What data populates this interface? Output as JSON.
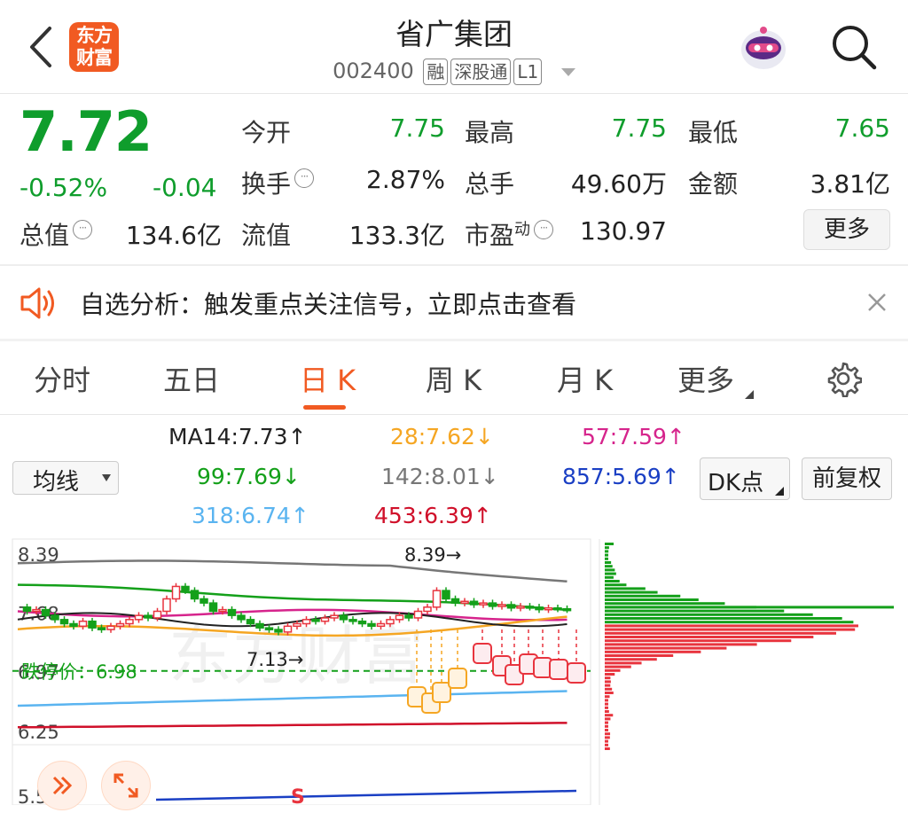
{
  "header": {
    "app_logo_text": [
      "东方",
      "财富"
    ],
    "title": "省广集团",
    "code": "002400",
    "tags": [
      "融",
      "深股通",
      "L1"
    ]
  },
  "quote": {
    "price": "7.72",
    "change_pct": "-0.52%",
    "change": "-0.04",
    "fields": [
      {
        "label": "今开",
        "value": "7.75",
        "color": "green"
      },
      {
        "label": "最高",
        "value": "7.75",
        "color": "green"
      },
      {
        "label": "最低",
        "value": "7.65",
        "color": "green"
      },
      {
        "label": "换手",
        "value": "2.87%",
        "color": "dark",
        "info": true
      },
      {
        "label": "总手",
        "value": "49.60万",
        "color": "dark"
      },
      {
        "label": "金额",
        "value": "3.81亿",
        "color": "dark"
      },
      {
        "label": "总值",
        "value": "134.6亿",
        "color": "dark",
        "info": true
      },
      {
        "label": "流值",
        "value": "133.3亿",
        "color": "dark"
      },
      {
        "label": "市盈",
        "sup": "动",
        "value": "130.97",
        "color": "dark",
        "info": true
      }
    ],
    "more_label": "更多"
  },
  "banner": {
    "text": "自选分析：触发重点关注信号，立即点击查看"
  },
  "tabs": [
    "分时",
    "五日",
    "日 K",
    "周 K",
    "月 K",
    "更多"
  ],
  "active_tab": 2,
  "indicators": {
    "ma_select": "均线",
    "dk_button": "DK点",
    "fuquan_button": "前复权",
    "mas": [
      {
        "text": "MA14:7.73",
        "arrow": "↑",
        "color": "#222222"
      },
      {
        "text": "28:7.62",
        "arrow": "↓",
        "color": "#f5a623"
      },
      {
        "text": "57:7.59",
        "arrow": "↑",
        "color": "#d6248c"
      },
      {
        "text": "99:7.69",
        "arrow": "↓",
        "color": "#14a01a"
      },
      {
        "text": "142:8.01",
        "arrow": "↓",
        "color": "#777777"
      },
      {
        "text": "857:5.69",
        "arrow": "↑",
        "color": "#1a3fc4"
      },
      {
        "text": "318:6.74",
        "arrow": "↑",
        "color": "#5ab4f0"
      },
      {
        "text": "453:6.39",
        "arrow": "↑",
        "color": "#d0102a"
      }
    ]
  },
  "chart": {
    "y_labels": [
      "8.39",
      "7.68",
      "6.97",
      "6.25",
      "5.54"
    ],
    "high_annotation": "8.39→",
    "low_annotation": "7.13→",
    "limit_down_label": "跌停价：",
    "limit_down_value": "6.98",
    "watermark": "东方财富",
    "s_marker": "S",
    "colors": {
      "up": "#e8343e",
      "down": "#14a01a"
    }
  }
}
